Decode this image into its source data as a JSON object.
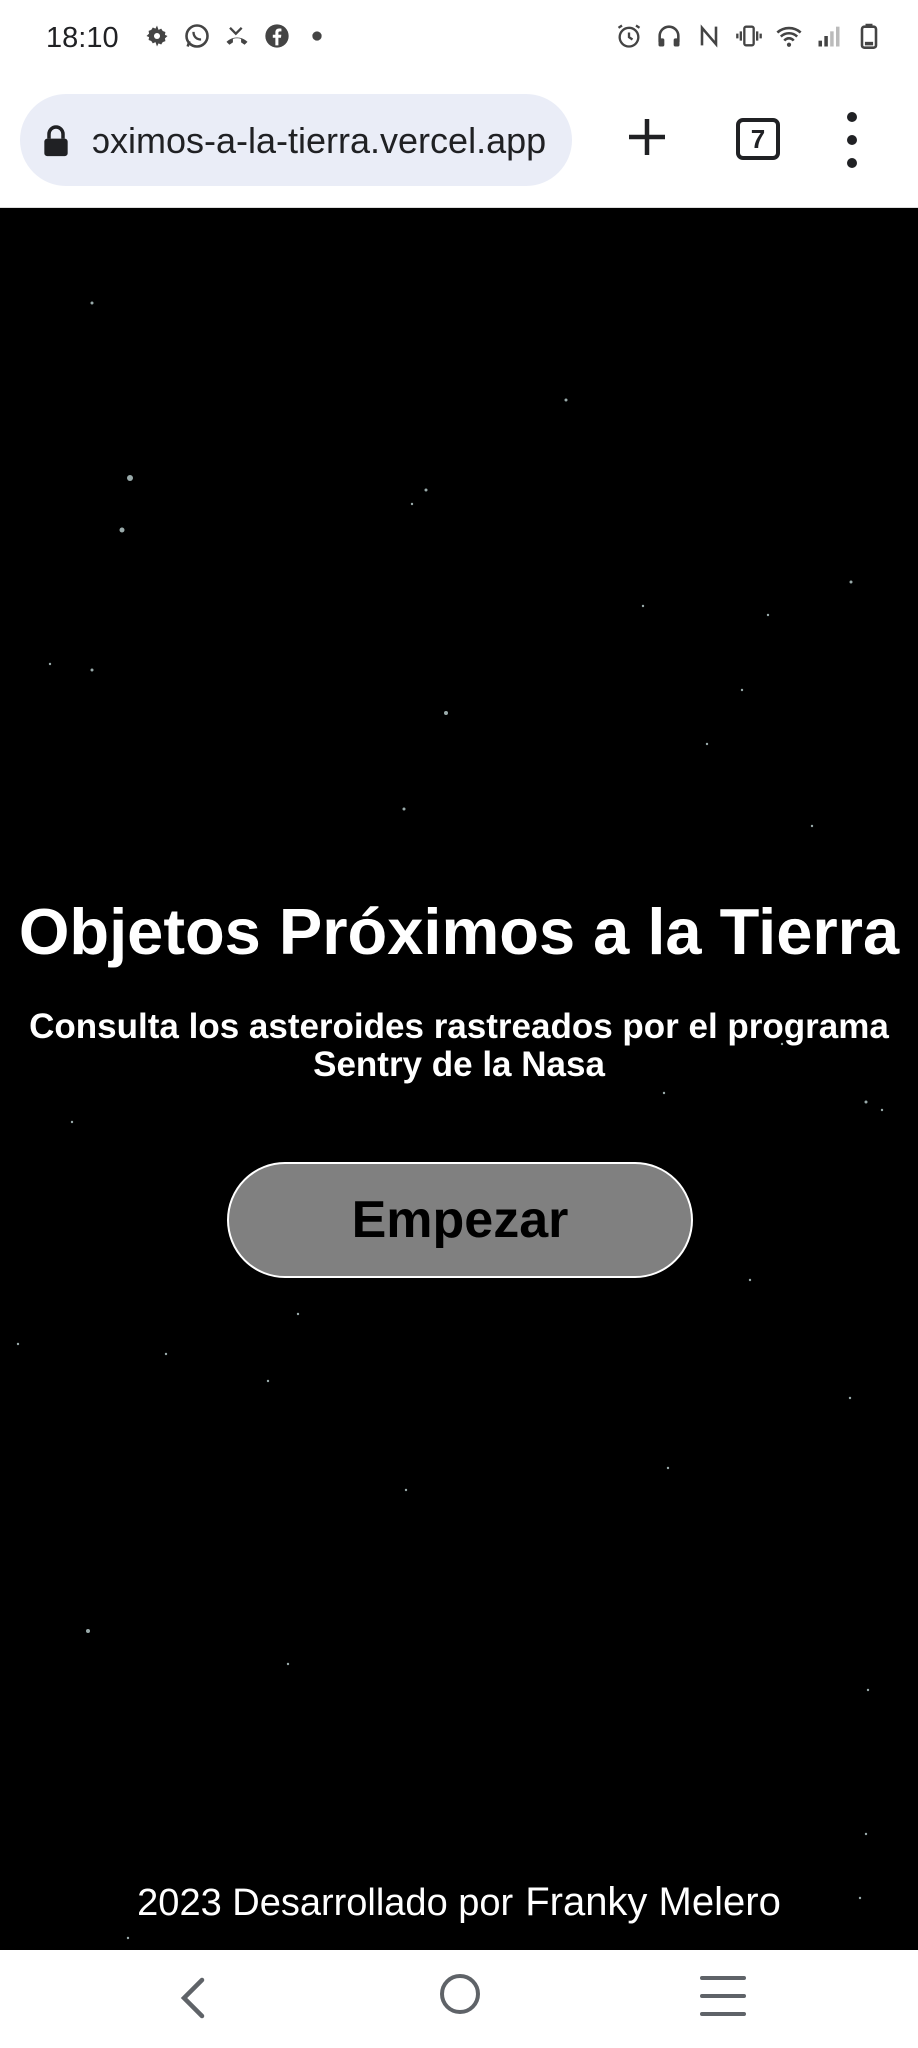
{
  "status_bar": {
    "time": "18:10",
    "left_icons": [
      "gear-icon",
      "whatsapp-icon",
      "missed-call-icon",
      "facebook-icon",
      "dot-icon"
    ],
    "right_icons": [
      "alarm-icon",
      "headphones-icon",
      "nfc-icon",
      "vibrate-icon",
      "wifi-icon",
      "signal-icon",
      "battery-icon"
    ]
  },
  "browser": {
    "url": "ɔximos-a-la-tierra.vercel.app",
    "tab_count": "7"
  },
  "page": {
    "title": "Objetos Próximos a la Tierra",
    "subtitle": "Consulta los asteroides rastreados por el programa Sentry de la Nasa",
    "start_label": "Empezar",
    "footer_text": "2023 Desarrollado por",
    "footer_author": "Franky Melero"
  },
  "colors": {
    "background": "#000000",
    "button": "#808080",
    "text": "#ffffff"
  }
}
